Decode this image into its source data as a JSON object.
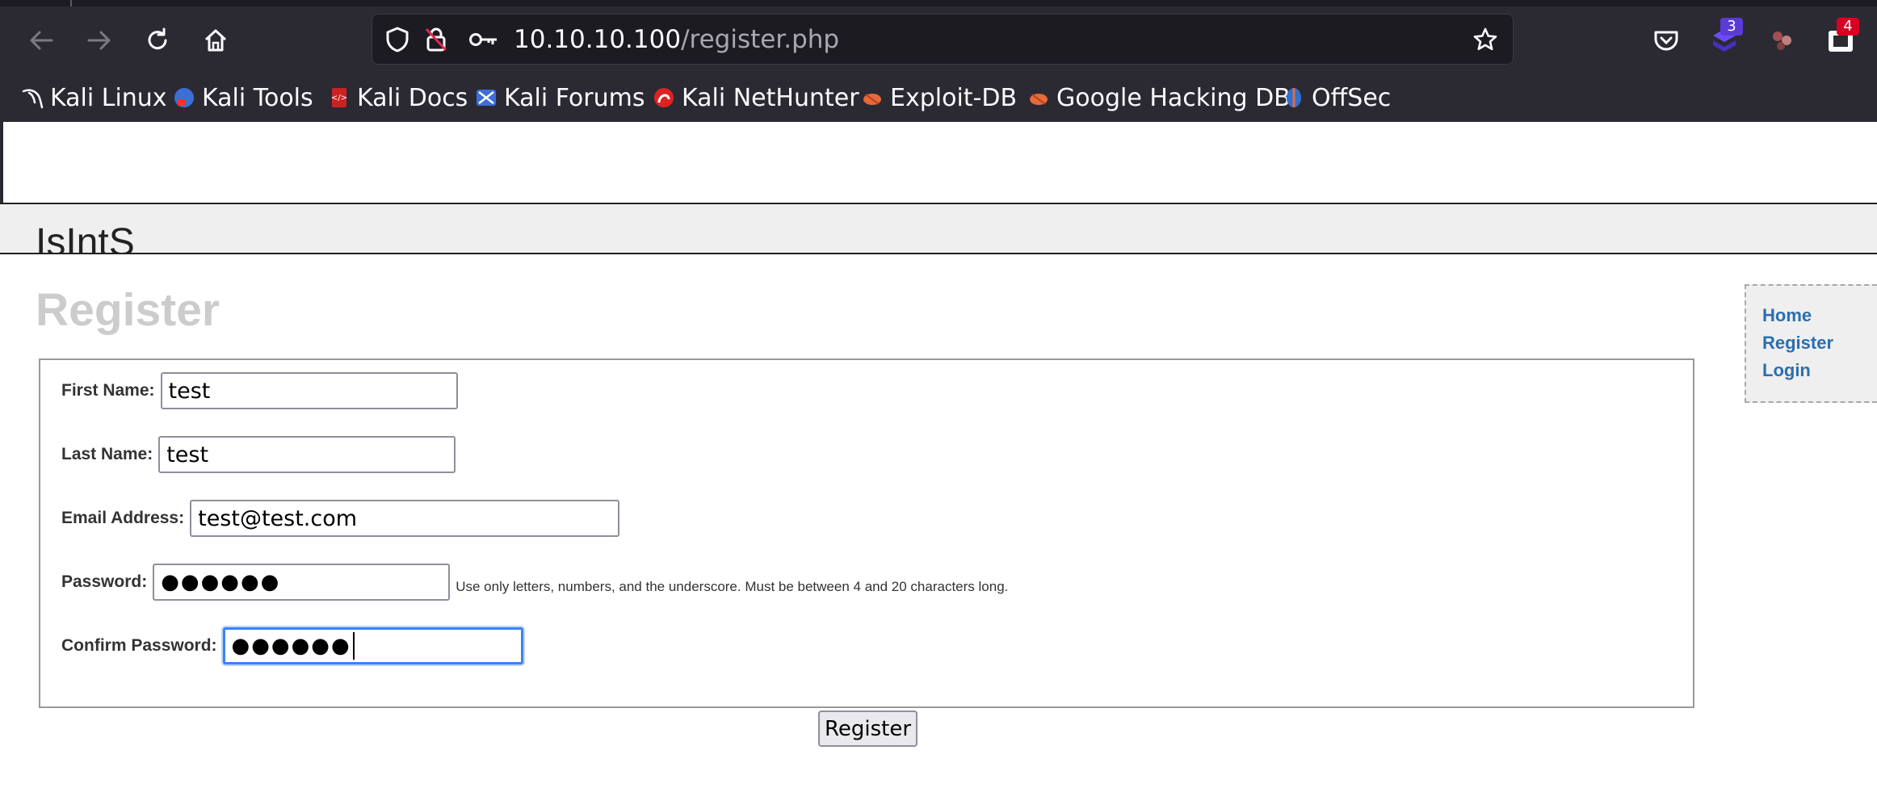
{
  "browser": {
    "url_host": "10.10.10.100",
    "url_path": "/register.php",
    "extensions": [
      {
        "icon": "pocket-icon"
      },
      {
        "icon": "extension-icon",
        "badge": "3",
        "badge_color": "#5b3bd6"
      },
      {
        "icon": "extension-icon-2"
      },
      {
        "icon": "extension-icon-3",
        "badge": "4",
        "badge_color": "#d70022"
      }
    ]
  },
  "bookmarks": [
    {
      "label": "Kali Linux",
      "icon": "kali-dragon-icon"
    },
    {
      "label": "Kali Tools",
      "icon": "kali-tools-icon"
    },
    {
      "label": "Kali Docs",
      "icon": "kali-docs-icon"
    },
    {
      "label": "Kali Forums",
      "icon": "kali-forums-icon"
    },
    {
      "label": "Kali NetHunter",
      "icon": "kali-nethunter-icon"
    },
    {
      "label": "Exploit-DB",
      "icon": "exploit-db-icon"
    },
    {
      "label": "Google Hacking DB",
      "icon": "ghdb-icon"
    },
    {
      "label": "OffSec",
      "icon": "offsec-icon"
    }
  ],
  "site": {
    "title": "IsIntS",
    "heading": "Register"
  },
  "form": {
    "first_name": {
      "label": "First Name:",
      "value": "test"
    },
    "last_name": {
      "label": "Last Name:",
      "value": "test"
    },
    "email": {
      "label": "Email Address:",
      "value": "test@test.com"
    },
    "password": {
      "label": "Password:",
      "value": "●●●●●●",
      "hint": "Use only letters, numbers, and the underscore. Must be between 4 and 20 characters long."
    },
    "confirm_password": {
      "label": "Confirm Password:",
      "value": "●●●●●●"
    },
    "submit_label": "Register"
  },
  "sidebar": {
    "links": [
      "Home",
      "Register",
      "Login"
    ]
  }
}
